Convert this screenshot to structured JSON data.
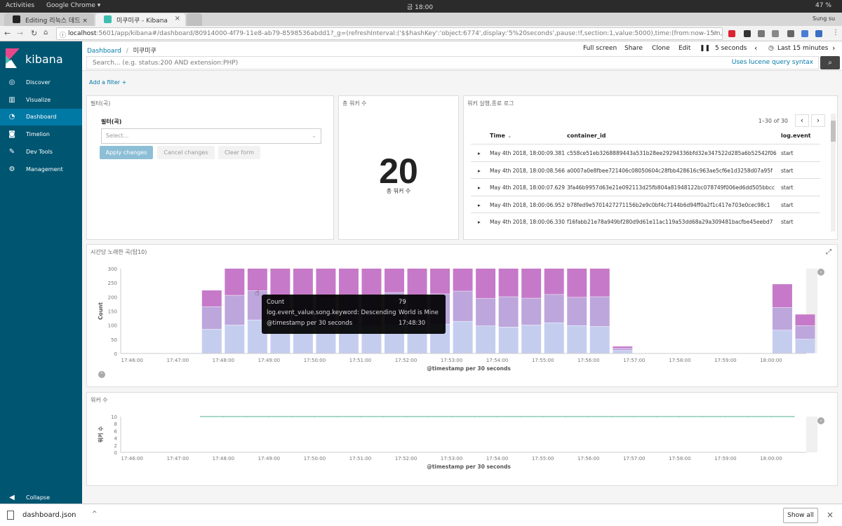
{
  "system": {
    "activities": "Activities",
    "app": "Google Chrome ▾",
    "clock": "금 18:00",
    "battery": "47 %",
    "user": "Sung su"
  },
  "tabs": [
    {
      "label": "Editing 리눅스 데드 ×"
    },
    {
      "label": "미쿠미쿠 - Kibana"
    }
  ],
  "tab_close": "×",
  "address": {
    "host": "localhost",
    "rest": ":5601/app/kibana#/dashboard/80914000-4f79-11e8-ab79-8598536abdd1?_g=(refreshInterval:('$$hashKey':'object:6774',display:'5%20seconds',pause:!f,section:1,value:5000),time:(from:now-15m,mode:quick,to:n..."
  },
  "brand": {
    "name": "kibana",
    "accent": "#005571",
    "active": "#0079a5"
  },
  "sidebar": {
    "items": [
      {
        "label": "Discover",
        "icon": "compass-icon",
        "glyph": "◎"
      },
      {
        "label": "Visualize",
        "icon": "bar-chart-icon",
        "glyph": "▥"
      },
      {
        "label": "Dashboard",
        "icon": "dashboard-icon",
        "glyph": "◔"
      },
      {
        "label": "Timelion",
        "icon": "timelion-icon",
        "glyph": "◙"
      },
      {
        "label": "Dev Tools",
        "icon": "wrench-icon",
        "glyph": "✎"
      },
      {
        "label": "Management",
        "icon": "gear-icon",
        "glyph": "⚙"
      }
    ],
    "collapse": "Collapse"
  },
  "topnav": {
    "breadcrumb_root": "Dashboard",
    "breadcrumb_sep": "/",
    "breadcrumb_current": "미쿠미쿠",
    "fullscreen": "Full screen",
    "share": "Share",
    "clone": "Clone",
    "edit": "Edit",
    "interval": "5 seconds",
    "time": "Last 15 minutes",
    "search_placeholder": "Search... (e.g. status:200 AND extension:PHP)",
    "lucene": "Uses lucene query syntax",
    "add_filter": "Add a filter +"
  },
  "panel_filter": {
    "title": "필터(곡)",
    "field_label": "필터(곡)",
    "select_placeholder": "Select...",
    "apply": "Apply changes",
    "cancel": "Cancel changes",
    "clear": "Clear form"
  },
  "panel_metric": {
    "title": "총 워커 수",
    "value": "20",
    "label": "총 워커 수"
  },
  "panel_table": {
    "title": "워커 실행,종료 로그",
    "pager": "1–30 of 30",
    "columns": [
      "Time",
      "container_id",
      "log.event"
    ],
    "rows": [
      {
        "time": "May 4th 2018, 18:00:09.381",
        "id": "c558ce51eb3268889443a531b28ee29294336bfd32e347522d285a6b52542f06",
        "event": "start"
      },
      {
        "time": "May 4th 2018, 18:00:08.566",
        "id": "a0007a0e8fbee721406c08050604c28fbb428616c963ae5cf6e1d3258d07a95f",
        "event": "start"
      },
      {
        "time": "May 4th 2018, 18:00:07.629",
        "id": "3fa46b9957d63e21e092113d25fb804a81948122bc078749f006ed6dd505bbcc",
        "event": "start"
      },
      {
        "time": "May 4th 2018, 18:00:06.952",
        "id": "b78fed9e5701427271156b2e9c0bf4c7144b6d94ff0a2f1c417e703e0cec98c1",
        "event": "start"
      },
      {
        "time": "May 4th 2018, 18:00:06.330",
        "id": "f16fabb21e78a949bf280d9d61e11ac119a53dd68a29a309481bacfbe45eebd7",
        "event": "start"
      }
    ]
  },
  "chart_data": [
    {
      "type": "bar",
      "title": "시간당 노래한 곡(탑10)",
      "ylabel": "Count",
      "xlabel": "@timestamp per 30 seconds",
      "ylim": [
        0,
        300
      ],
      "yticks": [
        0,
        50,
        100,
        150,
        200,
        250,
        300
      ],
      "xticks": [
        "17:46:00",
        "17:47:00",
        "17:48:00",
        "17:49:00",
        "17:50:00",
        "17:51:00",
        "17:52:00",
        "17:53:00",
        "17:54:00",
        "17:55:00",
        "17:56:00",
        "17:57:00",
        "17:58:00",
        "17:59:00",
        "18:00:00"
      ],
      "colors": [
        "#c5cdef",
        "#bda6dc",
        "#c679c9"
      ],
      "bars": [
        {
          "x": "17:47:30",
          "stack": [
            85,
            80,
            58
          ]
        },
        {
          "x": "17:48:00",
          "stack": [
            100,
            105,
            95
          ]
        },
        {
          "x": "17:48:30",
          "stack": [
            118,
            103,
            79
          ]
        },
        {
          "x": "17:49:00",
          "stack": [
            95,
            100,
            105
          ]
        },
        {
          "x": "17:49:30",
          "stack": [
            100,
            103,
            97
          ]
        },
        {
          "x": "17:50:00",
          "stack": [
            95,
            100,
            105
          ]
        },
        {
          "x": "17:50:30",
          "stack": [
            100,
            105,
            95
          ]
        },
        {
          "x": "17:51:00",
          "stack": [
            95,
            110,
            95
          ]
        },
        {
          "x": "17:51:30",
          "stack": [
            100,
            115,
            85
          ]
        },
        {
          "x": "17:52:00",
          "stack": [
            95,
            105,
            100
          ]
        },
        {
          "x": "17:52:30",
          "stack": [
            103,
            107,
            90
          ]
        },
        {
          "x": "17:53:00",
          "stack": [
            113,
            107,
            80
          ]
        },
        {
          "x": "17:53:30",
          "stack": [
            97,
            97,
            106
          ]
        },
        {
          "x": "17:54:00",
          "stack": [
            93,
            107,
            100
          ]
        },
        {
          "x": "17:54:30",
          "stack": [
            100,
            95,
            105
          ]
        },
        {
          "x": "17:55:00",
          "stack": [
            108,
            100,
            92
          ]
        },
        {
          "x": "17:55:30",
          "stack": [
            98,
            100,
            102
          ]
        },
        {
          "x": "17:56:00",
          "stack": [
            95,
            105,
            100
          ]
        },
        {
          "x": "17:56:30",
          "stack": [
            10,
            8,
            7
          ]
        },
        {
          "x": "18:00:00",
          "stack": [
            82,
            80,
            83
          ]
        },
        {
          "x": "18:00:30",
          "stack": [
            50,
            48,
            40
          ]
        }
      ],
      "tooltip": {
        "rows": [
          {
            "key": "Count",
            "value": "79"
          },
          {
            "key": "log.event_value.song.keyword: Descending",
            "value": "World is Mine"
          },
          {
            "key": "@timestamp per 30 seconds",
            "value": "17:48:30"
          }
        ]
      }
    },
    {
      "type": "line",
      "title": "워커 수",
      "ylabel": "워커 수",
      "xlabel": "@timestamp per 30 seconds",
      "ylim": [
        0,
        10
      ],
      "yticks": [
        0,
        2,
        4,
        6,
        8,
        10
      ],
      "xticks": [
        "17:46:00",
        "17:47:00",
        "17:48:00",
        "17:49:00",
        "17:50:00",
        "17:51:00",
        "17:52:00",
        "17:53:00",
        "17:54:00",
        "17:55:00",
        "17:56:00",
        "17:57:00",
        "17:58:00",
        "17:59:00",
        "18:00:00"
      ],
      "color": "#54b399",
      "x": [
        "17:47:30",
        "18:00:30"
      ],
      "values": [
        10,
        10
      ]
    }
  ],
  "download": {
    "file": "dashboard.json",
    "show_all": "Show all",
    "close": "×",
    "menu": "^"
  }
}
